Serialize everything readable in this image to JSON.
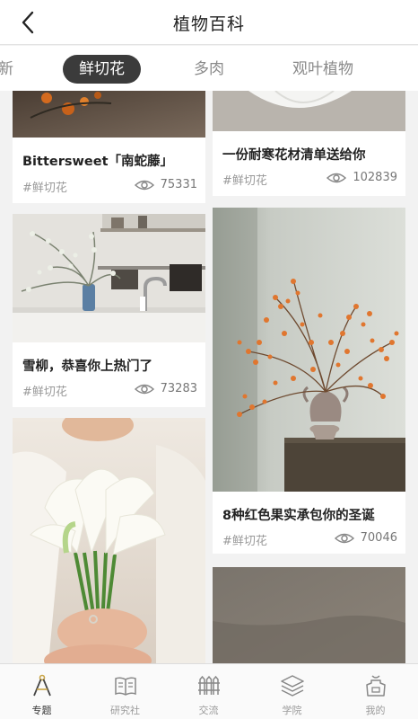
{
  "header": {
    "title": "植物百科"
  },
  "tabs": [
    {
      "label": "新"
    },
    {
      "label": "鲜切花"
    },
    {
      "label": "多肉"
    },
    {
      "label": "观叶植物"
    }
  ],
  "active_tab": "鲜切花",
  "cards": [
    {
      "title": "Bittersweet「南蛇藤」",
      "tag": "#鲜切花",
      "views": "75331"
    },
    {
      "title": "一份耐寒花材清单送给你",
      "tag": "#鲜切花",
      "views": "102839"
    },
    {
      "title": "雪柳，恭喜你上热门了",
      "tag": "#鲜切花",
      "views": "73283"
    },
    {
      "title": "8种红色果实承包你的圣诞",
      "tag": "#鲜切花",
      "views": "70046"
    }
  ],
  "bottom_nav": [
    {
      "label": "专题"
    },
    {
      "label": "研究社"
    },
    {
      "label": "交流"
    },
    {
      "label": "学院"
    },
    {
      "label": "我的"
    }
  ],
  "active_nav": "专题",
  "icons": {
    "back": "chevron-left-icon",
    "views": "eye-icon",
    "nav": [
      "pencil-compass-icon",
      "book-icon",
      "fence-icon",
      "layers-icon",
      "apron-icon"
    ]
  },
  "colors": {
    "active_tab_bg": "#3b3b3b",
    "active_nav_icon": "#c9a445",
    "tag_text": "#999999"
  }
}
